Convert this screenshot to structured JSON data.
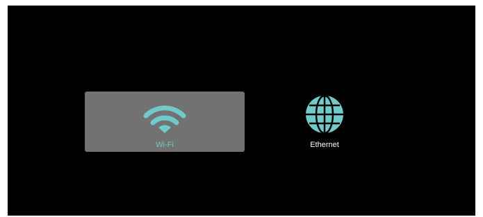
{
  "network_options": [
    {
      "label": "Wi-Fi",
      "icon": "wifi-icon",
      "selected": true
    },
    {
      "label": "Ethernet",
      "icon": "globe-icon",
      "selected": false
    }
  ],
  "colors": {
    "accent": "#6ecbc9",
    "selected_tile": "#727272",
    "background": "#000000"
  }
}
